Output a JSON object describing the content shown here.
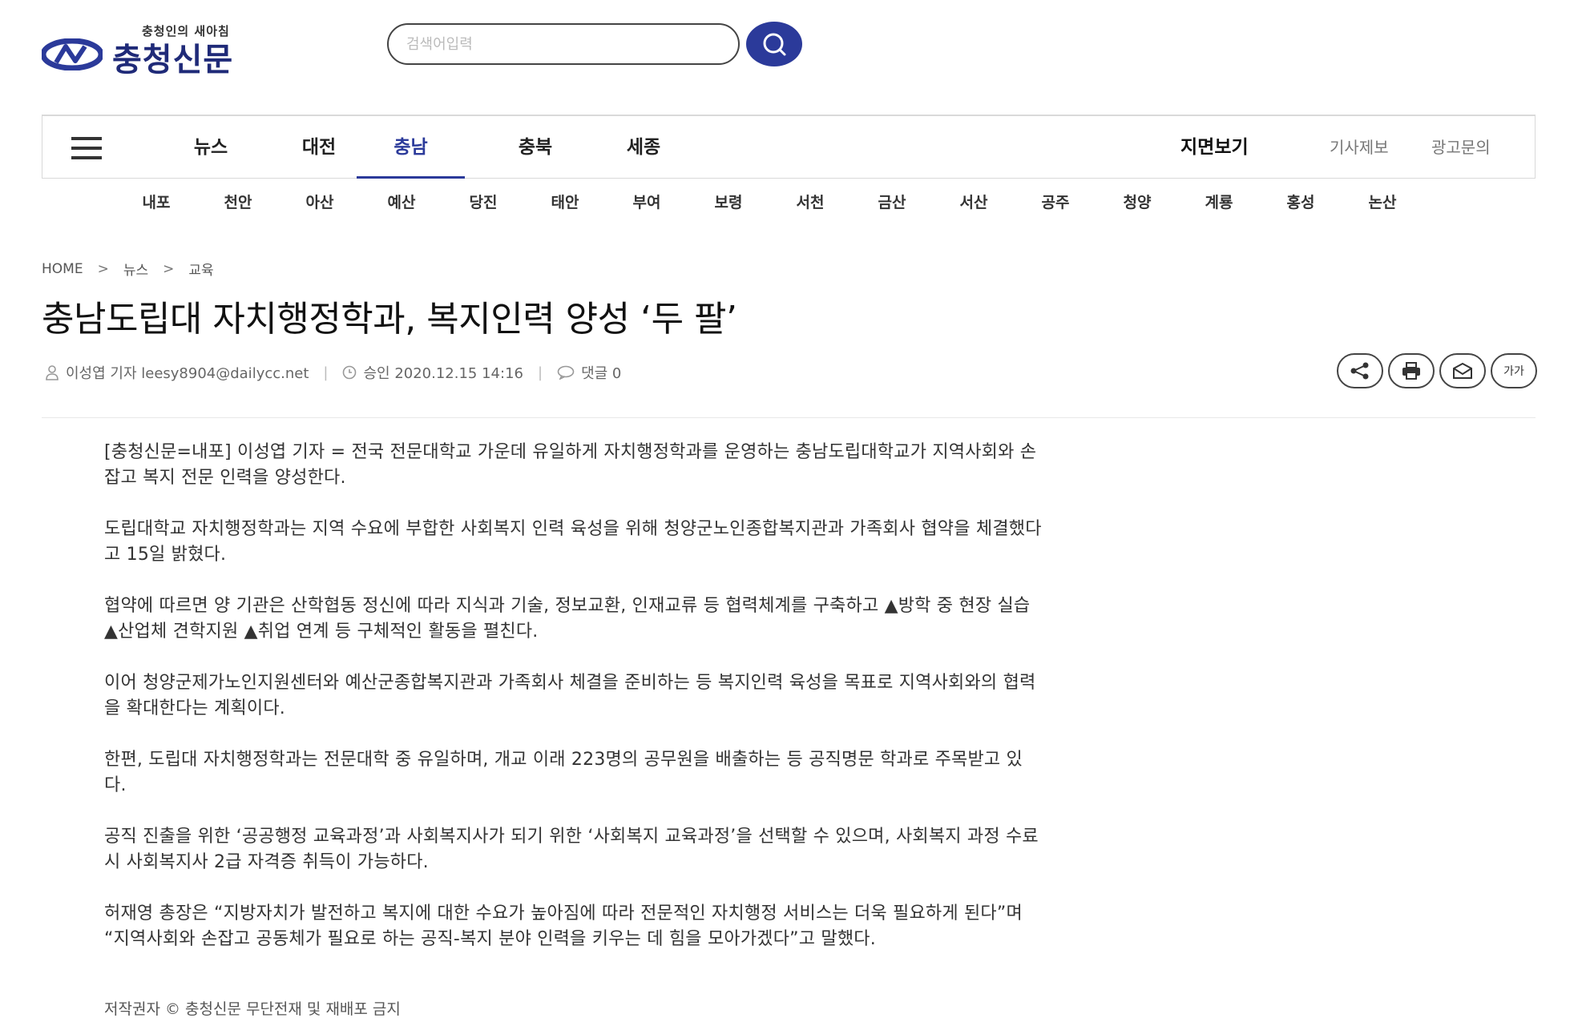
{
  "header": {
    "tagline": "충청인의 새아침",
    "site_name": "충청신문",
    "search_placeholder": "검색어입력"
  },
  "nav": {
    "items": [
      {
        "label": "뉴스"
      },
      {
        "label": "대전"
      },
      {
        "label": "충남",
        "active": true
      },
      {
        "label": "충북"
      },
      {
        "label": "세종"
      }
    ],
    "right_primary": "지면보기",
    "right_links": [
      "기사제보",
      "광고문의"
    ]
  },
  "sub_nav": [
    "내포",
    "천안",
    "아산",
    "예산",
    "당진",
    "태안",
    "부여",
    "보령",
    "서천",
    "금산",
    "서산",
    "공주",
    "청양",
    "계룡",
    "홍성",
    "논산"
  ],
  "breadcrumb": [
    "HOME",
    "뉴스",
    "교육"
  ],
  "article": {
    "title": "충남도립대 자치행정학과, 복지인력 양성 ‘두 팔’",
    "reporter": "이성엽 기자 leesy8904@dailycc.net",
    "approved": "승인 2020.12.15 14:16",
    "comments": "댓글 0",
    "font_size_label": "가가",
    "paragraphs": [
      "[충청신문=내포] 이성엽 기자 = 전국 전문대학교 가운데 유일하게 자치행정학과를 운영하는 충남도립대학교가 지역사회와 손잡고 복지 전문 인력을 양성한다.",
      "도립대학교 자치행정학과는 지역 수요에 부합한 사회복지 인력 육성을 위해 청양군노인종합복지관과 가족회사 협약을 체결했다고 15일 밝혔다.",
      "협약에 따르면 양 기관은 산학협동 정신에 따라 지식과 기술, 정보교환, 인재교류 등 협력체계를 구축하고 ▲방학 중 현장 실습 ▲산업체 견학지원 ▲취업 연계 등 구체적인 활동을 펼친다.",
      "이어 청양군제가노인지원센터와 예산군종합복지관과 가족회사 체결을 준비하는 등 복지인력 육성을 목표로 지역사회와의 협력을 확대한다는 계획이다.",
      "한편, 도립대 자치행정학과는 전문대학 중 유일하며, 개교 이래 223명의 공무원을 배출하는 등 공직명문 학과로 주목받고 있다.",
      "공직 진출을 위한 ‘공공행정 교육과정’과 사회복지사가 되기 위한 ‘사회복지 교육과정’을 선택할 수 있으며, 사회복지 과정 수료 시 사회복지사 2급 자격증 취득이 가능하다.",
      "허재영 총장은 “지방자치가 발전하고 복지에 대한 수요가 높아짐에 따라 전문적인 자치행정 서비스는 더욱 필요하게 된다”며 “지역사회와 손잡고 공동체가 필요로 하는 공직-복지 분야 인력을 키우는 데 힘을 모아가겠다”고 말했다."
    ],
    "copyright": "저작권자 © 충청신문 무단전재 및 재배포 금지"
  },
  "colors": {
    "brand": "#2b3a9a",
    "logo_text": "#1f2a78"
  }
}
